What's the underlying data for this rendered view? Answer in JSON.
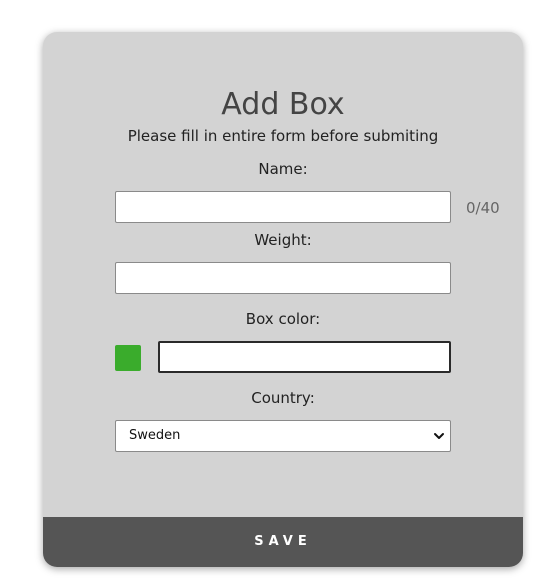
{
  "form": {
    "title": "Add Box",
    "subtitle": "Please fill in entire form before submiting",
    "name_label": "Name:",
    "name_value": "",
    "name_counter": "0/40",
    "weight_label": "Weight:",
    "weight_value": "",
    "color_label": "Box color:",
    "color_swatch": "#3aac2c",
    "color_value": "",
    "country_label": "Country:",
    "country_selected": "Sweden",
    "save_label": "SAVE"
  },
  "colors": {
    "card_background": "#d3d3d3",
    "save_button": "#555555"
  }
}
